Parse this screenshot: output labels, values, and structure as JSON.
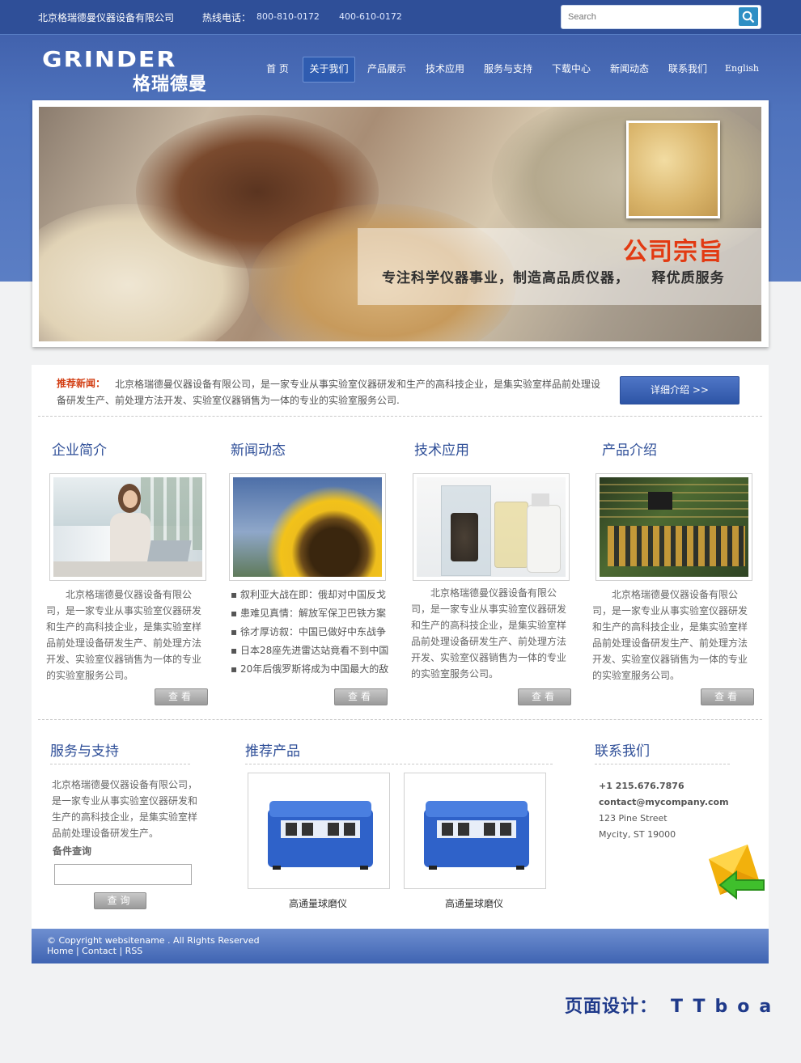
{
  "header": {
    "company": "北京格瑞德曼仪器设备有限公司",
    "hotline_label": "热线电话：",
    "phone1": "800-810-0172",
    "phone2": "400-610-0172",
    "search_placeholder": "Search"
  },
  "logo": {
    "en": "GRINDER",
    "cn": "格瑞德曼"
  },
  "nav": {
    "items": [
      {
        "label": "首 页"
      },
      {
        "label": "关于我们"
      },
      {
        "label": "产品展示"
      },
      {
        "label": "技术应用"
      },
      {
        "label": "服务与支持"
      },
      {
        "label": "下载中心"
      },
      {
        "label": "新闻动态"
      },
      {
        "label": "联系我们"
      },
      {
        "label": "English"
      }
    ],
    "active_index": 1
  },
  "banner": {
    "title": "公司宗旨",
    "slogan": "专注科学仪器事业，制造高品质仪器，    释优质服务"
  },
  "news": {
    "label": "推荐新闻：",
    "text": "北京格瑞德曼仪器设备有限公司，是一家专业从事实验室仪器研发和生产的高科技企业，是集实验室样品前处理设备研发生产、前处理方法开发、实验室仪器销售为一体的专业的实验室服务公司.",
    "button": "详细介绍 >>"
  },
  "columns": {
    "about": {
      "title": "企业简介",
      "text": "北京格瑞德曼仪器设备有限公司，是一家专业从事实验室仪器研发和生产的高科技企业，是集实验室样品前处理设备研发生产、前处理方法开发、实验室仪器销售为一体的专业的实验室服务公司。",
      "button": "查看"
    },
    "news": {
      "title": "新闻动态",
      "items": [
        "叙利亚大战在即：俄却对中国反戈",
        "患难见真情：解放军保卫巴铁方案",
        "徐才厚访叙：中国已做好中东战争",
        "日本28座先进雷达站竟看不到中国",
        "20年后俄罗斯将成为中国最大的敌"
      ],
      "button": "查看"
    },
    "tech": {
      "title": "技术应用",
      "text": "北京格瑞德曼仪器设备有限公司，是一家专业从事实验室仪器研发和生产的高科技企业，是集实验室样品前处理设备研发生产、前处理方法开发、实验室仪器销售为一体的专业的实验室服务公司。",
      "button": "查看"
    },
    "products": {
      "title": "产品介绍",
      "text": "北京格瑞德曼仪器设备有限公司，是一家专业从事实验室仪器研发和生产的高科技企业，是集实验室样品前处理设备研发生产、前处理方法开发、实验室仪器销售为一体的专业的实验室服务公司。",
      "button": "查看"
    }
  },
  "service": {
    "title": "服务与支持",
    "text": "北京格瑞德曼仪器设备有限公司，是一家专业从事实验室仪器研发和生产的高科技企业，是集实验室样品前处理设备研发生产。",
    "parts_label": "备件查询",
    "button": "查询"
  },
  "recommend": {
    "title": "推荐产品",
    "items": [
      {
        "name": "高通量球磨仪"
      },
      {
        "name": "高通量球磨仪"
      }
    ]
  },
  "contact": {
    "title": "联系我们",
    "phone": "+1 215.676.7876",
    "email": "contact@mycompany.com",
    "street": "123 Pine Street",
    "city": "Mycity, ST 19000"
  },
  "footer": {
    "copyright": "© Copyright websitename . All Rights Reserved",
    "links": "Home | Contact | RSS"
  },
  "design_credit": {
    "label": "页面设计：",
    "value": "TTboa"
  },
  "colors": {
    "brand_blue": "#2f4f98",
    "accent_red": "#d23d12",
    "button_blue": "#2d55a6"
  }
}
